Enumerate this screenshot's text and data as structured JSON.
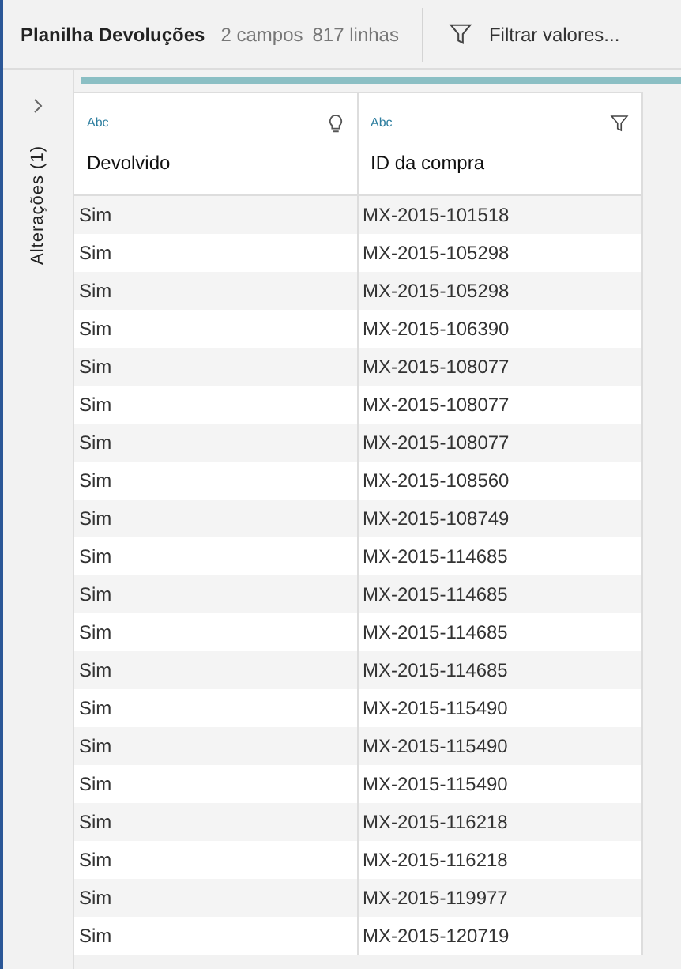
{
  "header": {
    "title": "Planilha Devoluções",
    "fields": "2 campos",
    "rows": "817 linhas",
    "filter_button": "Filtrar valores..."
  },
  "side_panel": {
    "label": "Alterações (1)",
    "expanded": false
  },
  "table": {
    "columns": [
      {
        "type": "Abc",
        "name": "Devolvido",
        "kind": "bulb"
      },
      {
        "type": "Abc",
        "name": "ID da compra",
        "kind": "filter"
      }
    ],
    "rows": [
      [
        "Sim",
        "MX-2015-101518"
      ],
      [
        "Sim",
        "MX-2015-105298"
      ],
      [
        "Sim",
        "MX-2015-105298"
      ],
      [
        "Sim",
        "MX-2015-106390"
      ],
      [
        "Sim",
        "MX-2015-108077"
      ],
      [
        "Sim",
        "MX-2015-108077"
      ],
      [
        "Sim",
        "MX-2015-108077"
      ],
      [
        "Sim",
        "MX-2015-108560"
      ],
      [
        "Sim",
        "MX-2015-108749"
      ],
      [
        "Sim",
        "MX-2015-114685"
      ],
      [
        "Sim",
        "MX-2015-114685"
      ],
      [
        "Sim",
        "MX-2015-114685"
      ],
      [
        "Sim",
        "MX-2015-114685"
      ],
      [
        "Sim",
        "MX-2015-115490"
      ],
      [
        "Sim",
        "MX-2015-115490"
      ],
      [
        "Sim",
        "MX-2015-115490"
      ],
      [
        "Sim",
        "MX-2015-116218"
      ],
      [
        "Sim",
        "MX-2015-116218"
      ],
      [
        "Sim",
        "MX-2015-119977"
      ],
      [
        "Sim",
        "MX-2015-120719"
      ]
    ]
  }
}
